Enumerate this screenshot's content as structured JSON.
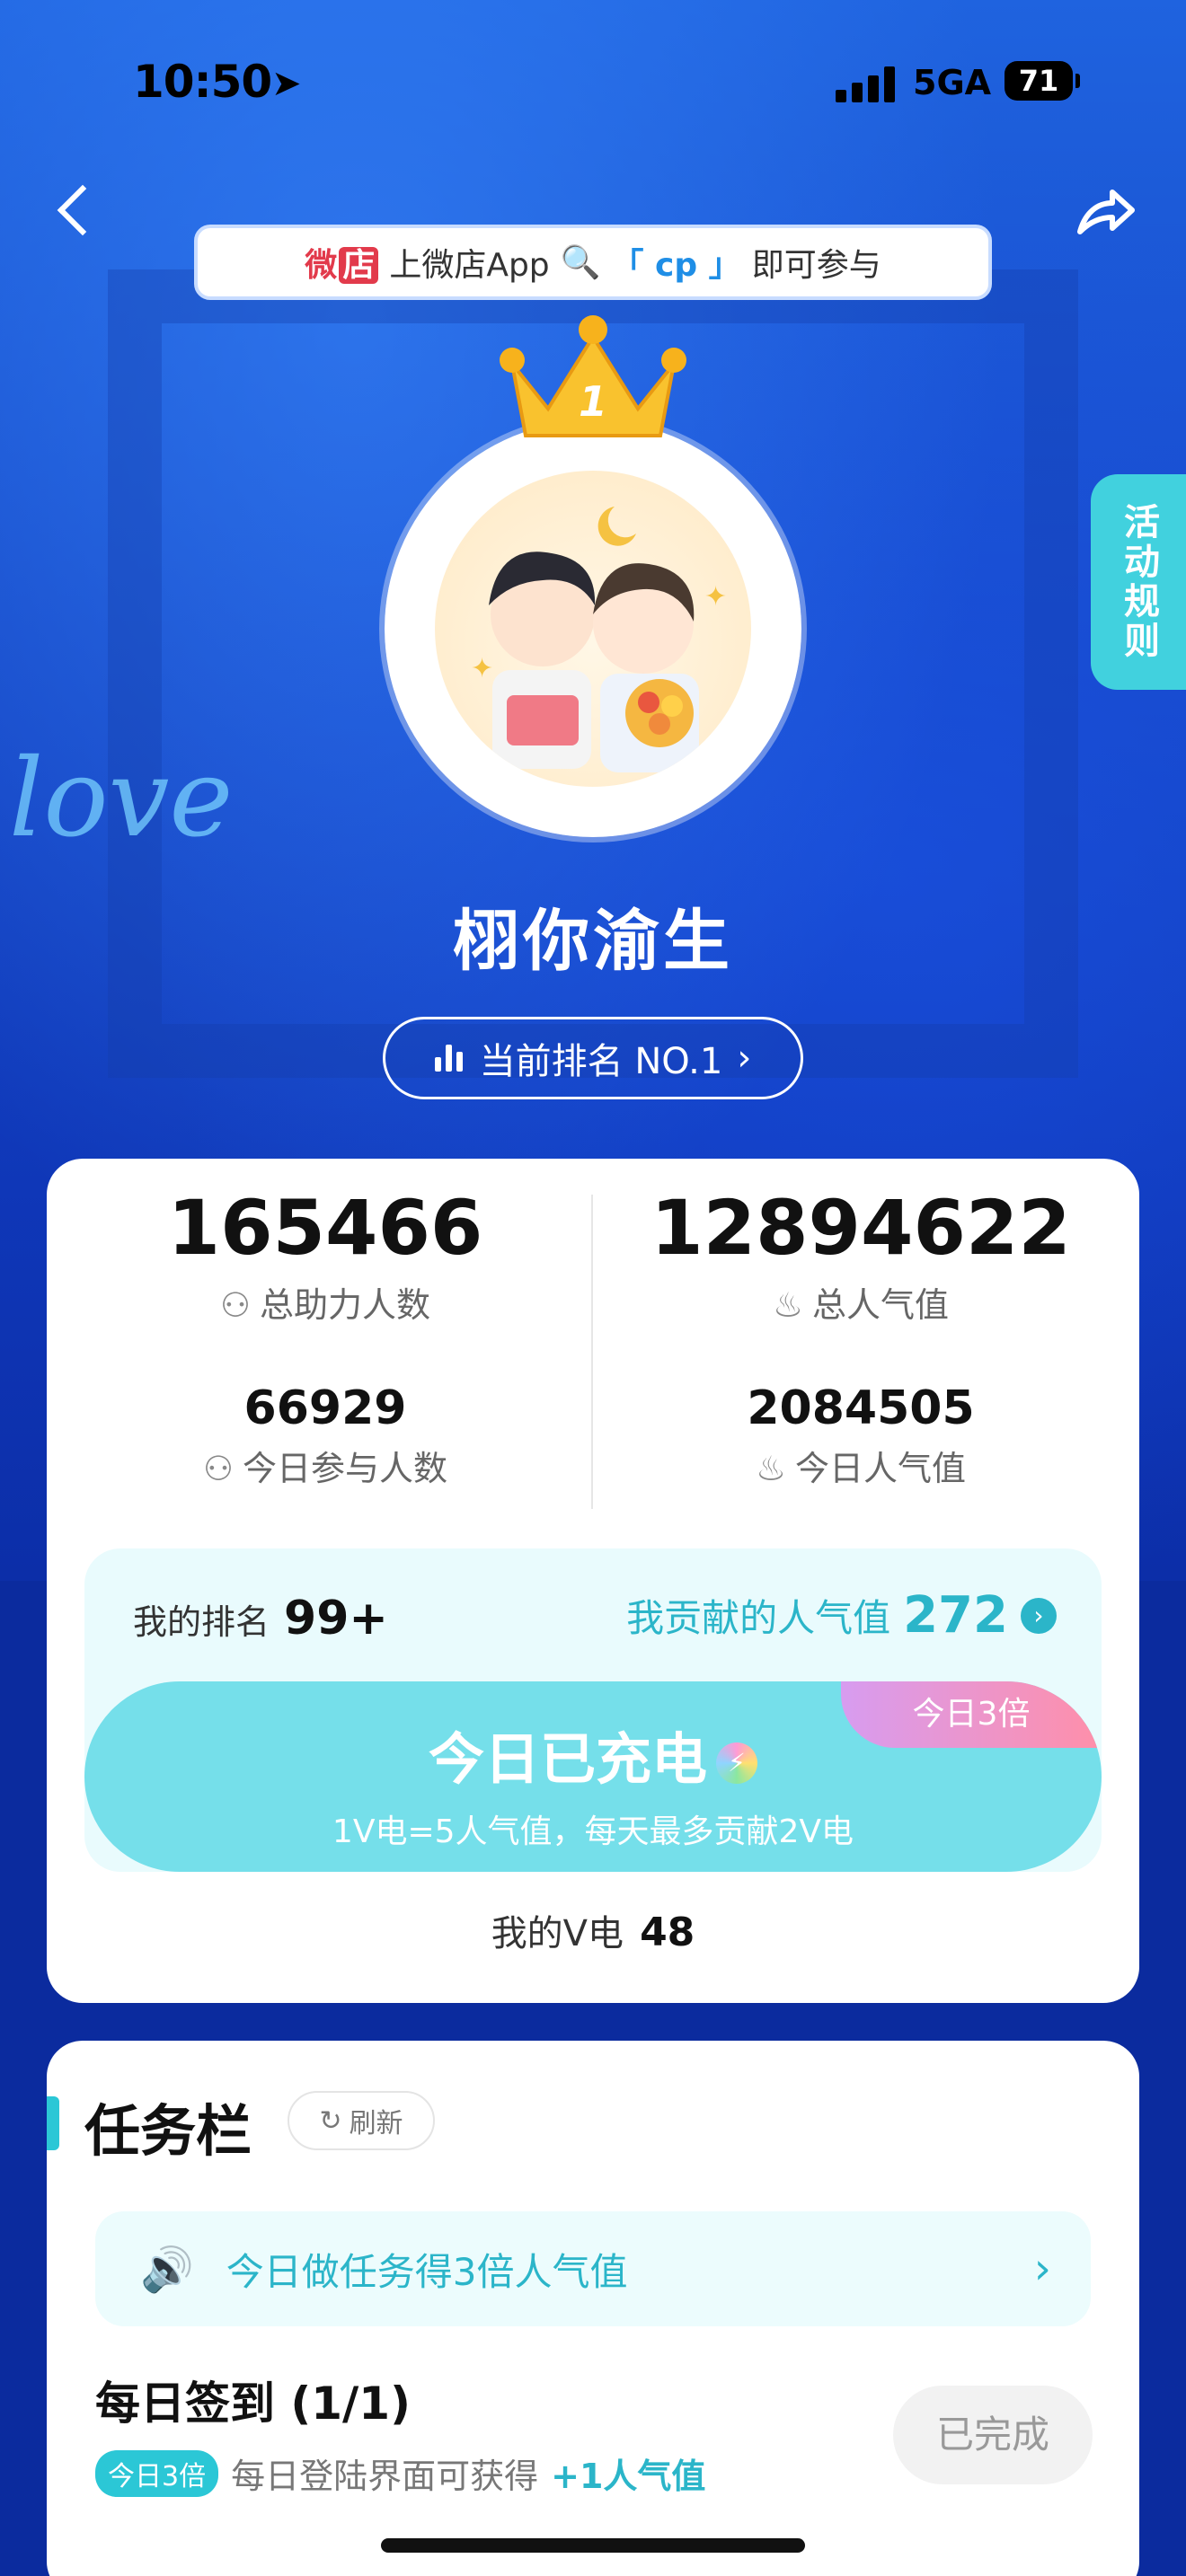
{
  "status_bar": {
    "time": "10:50",
    "network": "5GA",
    "battery": "71"
  },
  "search_tip": {
    "shop_prefix": "微",
    "shop_suffix": "店",
    "text_before": "上微店App",
    "keyword": "「 cp 」",
    "text_after": "即可参与"
  },
  "crown": {
    "rank_number": "1"
  },
  "rules_tab": {
    "label": "活动规则"
  },
  "decor": {
    "love_text": "love"
  },
  "fan_group": {
    "name": "栩你渝生"
  },
  "rank_pill": {
    "label": "当前排名 NO.1"
  },
  "stats": {
    "total_helpers": {
      "value": "165466",
      "label": "总助力人数"
    },
    "total_popularity": {
      "value": "12894622",
      "label": "总人气值"
    },
    "today_participants": {
      "value": "66929",
      "label": "今日参与人数"
    },
    "today_popularity": {
      "value": "2084505",
      "label": "今日人气值"
    }
  },
  "my_panel": {
    "rank_label": "我的排名",
    "rank_value": "99+",
    "contrib_label": "我贡献的人气值",
    "contrib_value": "272",
    "triple_tag": "今日3倍",
    "charge_title": "今日已充电",
    "charge_sub": "1V电=5人气值，每天最多贡献2V电",
    "v_label": "我的V电",
    "v_value": "48"
  },
  "tasks": {
    "title": "任务栏",
    "refresh_label": "刷新",
    "notice": "今日做任务得3倍人气值",
    "items": [
      {
        "title": "每日签到 (1/1)",
        "tag": "今日3倍",
        "desc": "每日登陆界面可获得",
        "reward": "+1人气值",
        "status": "已完成"
      }
    ]
  },
  "colors": {
    "accent": "#2bc7d6",
    "hero_blue": "#1648c8",
    "charge": "#75dfea"
  }
}
